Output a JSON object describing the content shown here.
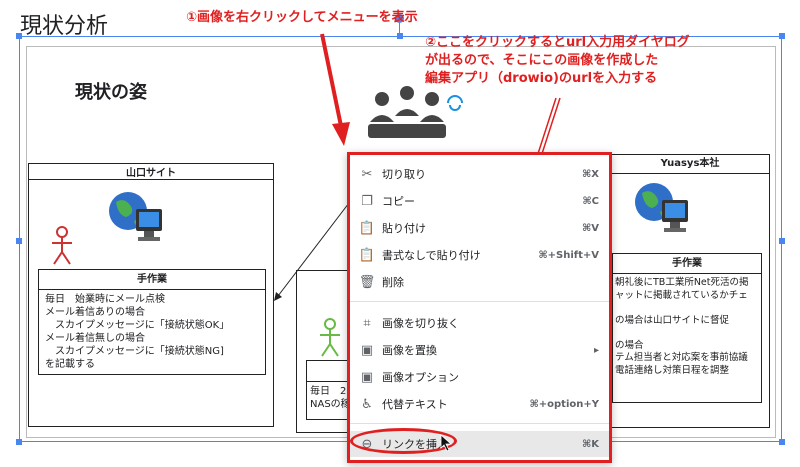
{
  "page_title": "現状分析",
  "slide_heading": "現状の姿",
  "annotations": {
    "line1": "①画像を右クリックしてメニューを表示",
    "line2": "②ここをクリックするとurl入力用ダイヤログ\nが出るので、そこにこの画像を作成した\n編集アプリ（drowio)のurlを入力する"
  },
  "left_panel": {
    "title": "山口サイト",
    "sub_title": "手作業",
    "notes": "毎日　始業時にメール点検\nメール着信ありの場合\n　スカイプメッセージに「接続状態OK」\nメール着信無しの場合\n　スカイプメッセージに「接続状態NG]\nを記載する"
  },
  "mid_panel": {
    "notes": "毎日　2\nNASの稼"
  },
  "right_panel": {
    "title": "Yuasys本社",
    "sub_title": "手作業",
    "notes": "朝礼後にTB工業所Net死活の掲\nャットに掲載されているかチェ\n\nの場合は山口サイトに督促\n\nの場合\nテム担当者と対応案を事前協議\n電話連絡し対策日程を調整"
  },
  "context_menu": {
    "items": [
      {
        "icon": "✂",
        "label": "切り取り",
        "shortcut": "⌘X"
      },
      {
        "icon": "❐",
        "label": "コピー",
        "shortcut": "⌘C"
      },
      {
        "icon": "📋",
        "label": "貼り付け",
        "shortcut": "⌘V"
      },
      {
        "icon": "📋",
        "label": "書式なしで貼り付け",
        "shortcut": "⌘+Shift+V"
      },
      {
        "icon": "🗑",
        "label": "削除",
        "shortcut": ""
      },
      {
        "icon": "⌗",
        "label": "画像を切り抜く",
        "shortcut": ""
      },
      {
        "icon": "▣",
        "label": "画像を置換",
        "shortcut": "▸"
      },
      {
        "icon": "▣",
        "label": "画像オプション",
        "shortcut": ""
      },
      {
        "icon": "♿",
        "label": "代替テキスト",
        "shortcut": "⌘+option+Y"
      },
      {
        "icon": "⊖",
        "label": "リンクを挿入",
        "shortcut": "⌘K"
      }
    ]
  },
  "colors": {
    "accent": "#e02020",
    "selection": "#4a86f0",
    "figure_red": "#cc3333",
    "figure_green": "#66bb44"
  }
}
